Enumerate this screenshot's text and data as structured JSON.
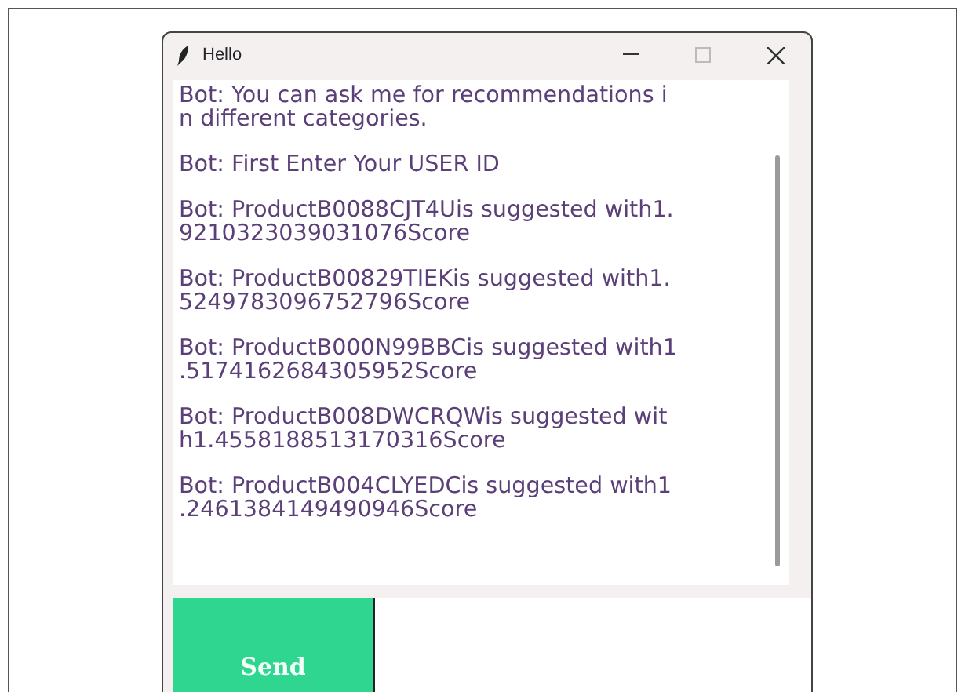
{
  "window": {
    "title": "Hello"
  },
  "messages": [
    {
      "lines": [
        "Bot: You can ask me for recommendations i",
        "n different categories."
      ]
    },
    {
      "lines": [
        "Bot: First Enter Your USER ID"
      ]
    },
    {
      "lines": [
        "Bot: ProductB0088CJT4Uis suggested with1.",
        "9210323039031076Score"
      ]
    },
    {
      "lines": [
        "Bot: ProductB00829TIEKis suggested with1.",
        "5249783096752796Score"
      ]
    },
    {
      "lines": [
        "Bot: ProductB000N99BBCis suggested with1",
        ".5174162684305952Score"
      ]
    },
    {
      "lines": [
        "Bot: ProductB008DWCRQWis suggested wit",
        "h1.4558188513170316Score"
      ]
    },
    {
      "lines": [
        "Bot: ProductB004CLYEDCis suggested with1",
        ".2461384149490946Score"
      ]
    }
  ],
  "send_button": {
    "label": "Send"
  }
}
